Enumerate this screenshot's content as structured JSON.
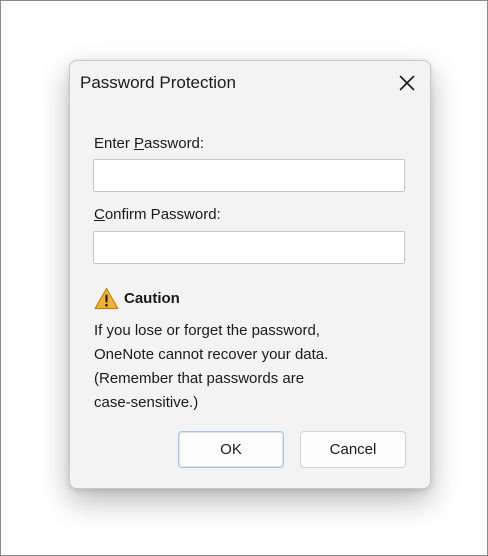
{
  "dialog": {
    "title": "Password Protection",
    "close_icon": "close-icon"
  },
  "enter_password": {
    "label_underlined_char": "P",
    "label_prefix": "Enter ",
    "label_suffix": "assword:",
    "value": ""
  },
  "confirm_password": {
    "label_underlined_char": "C",
    "label_suffix": "onfirm Password:",
    "value": ""
  },
  "caution": {
    "icon": "warning-icon",
    "title": "Caution",
    "lines": [
      "If you lose or forget the password,",
      "OneNote cannot recover your data.",
      "(Remember that passwords are",
      "case-sensitive.)"
    ]
  },
  "buttons": {
    "ok_label": "OK",
    "cancel_label": "Cancel"
  },
  "colors": {
    "warning_fill": "#F2B233",
    "warning_outline": "#B8860B",
    "ok_focus_border": "#A8C5E2"
  }
}
